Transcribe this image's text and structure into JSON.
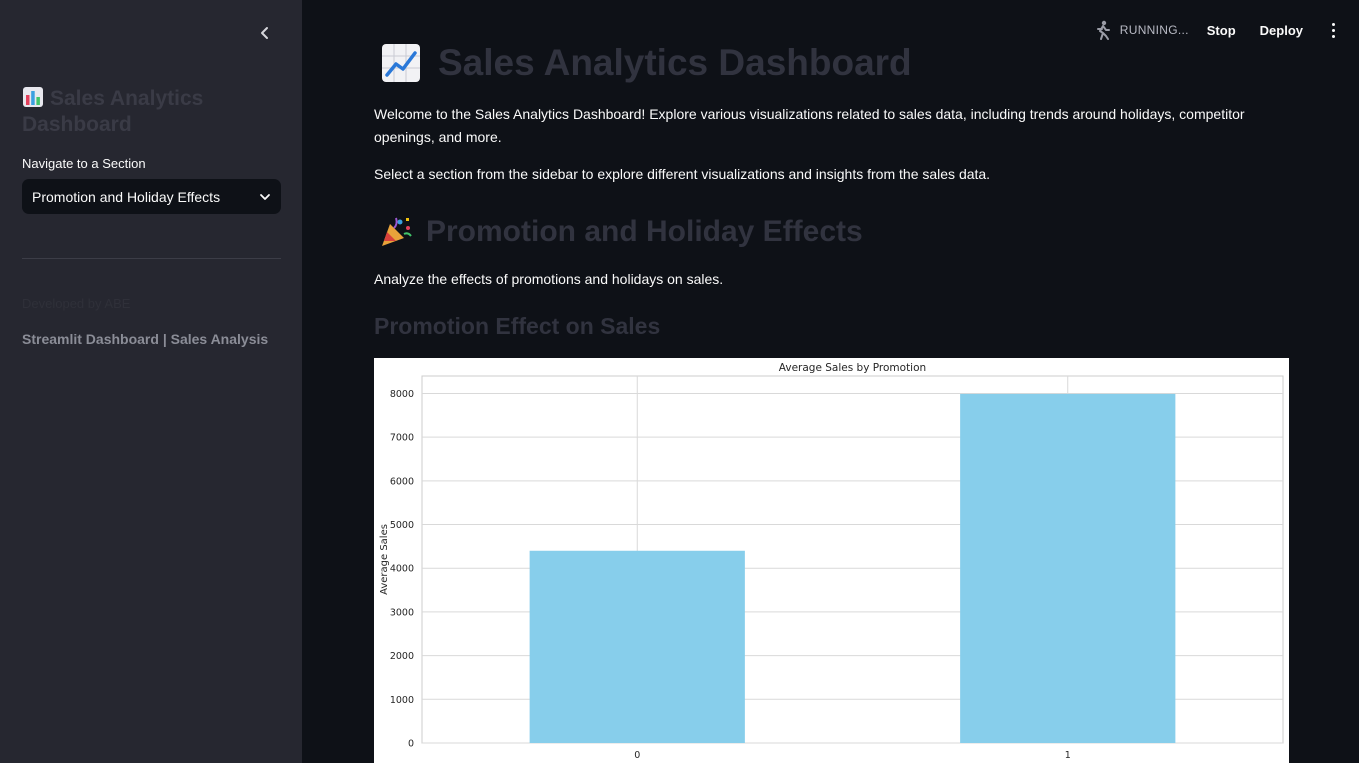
{
  "sidebar": {
    "title": "Sales Analytics Dashboard",
    "title_icon": "bar-chart-emoji",
    "nav_label": "Navigate to a Section",
    "selected_section": "Promotion and Holiday Effects",
    "credit": "Developed by ABE",
    "footer": "Streamlit Dashboard | Sales Analysis"
  },
  "toolbar": {
    "status": "RUNNING...",
    "stop": "Stop",
    "deploy": "Deploy"
  },
  "main": {
    "title": "Sales Analytics Dashboard",
    "title_icon": "chart-increasing-emoji",
    "intro": "Welcome to the Sales Analytics Dashboard! Explore various visualizations related to sales data, including trends around holidays, competitor openings, and more.",
    "instruction": "Select a section from the sidebar to explore different visualizations and insights from the sales data.",
    "section_title": "Promotion and Holiday Effects",
    "section_icon": "party-popper-emoji",
    "section_desc": "Analyze the effects of promotions and holidays on sales.",
    "subsection_title": "Promotion Effect on Sales"
  },
  "chart_data": {
    "type": "bar",
    "title": "Average Sales by Promotion",
    "categories": [
      "0",
      "1"
    ],
    "values": [
      4400,
      7990
    ],
    "xlabel": "",
    "ylabel": "Average Sales",
    "ylim": [
      0,
      8400
    ],
    "yticks": [
      0,
      1000,
      2000,
      3000,
      4000,
      5000,
      6000,
      7000,
      8000
    ],
    "grid": true,
    "bar_color": "#87ceeb"
  }
}
